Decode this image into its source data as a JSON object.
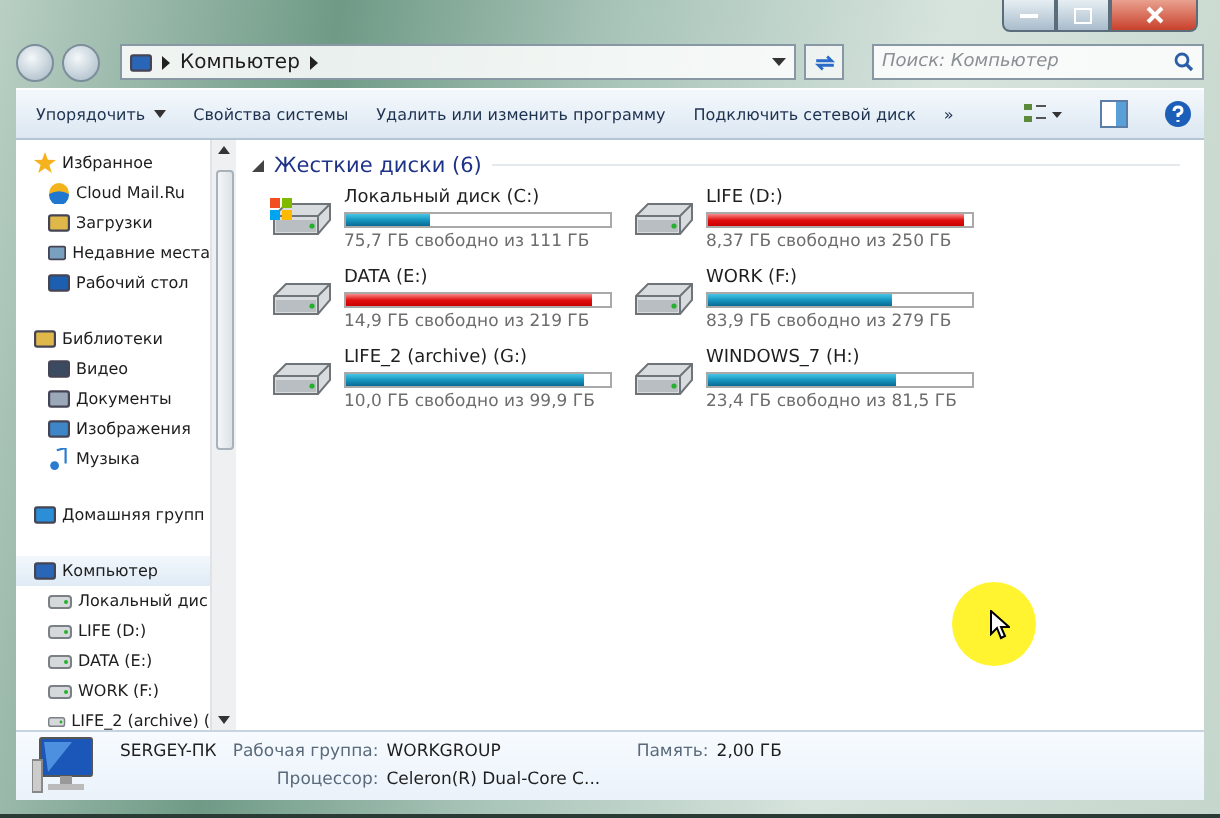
{
  "address_bar": {
    "crumbs": [
      "Компьютер"
    ]
  },
  "search": {
    "placeholder": "Поиск: Компьютер"
  },
  "toolbar": {
    "items": [
      "Упорядочить",
      "Свойства системы",
      "Удалить или изменить программу",
      "Подключить сетевой диск"
    ],
    "more": "»"
  },
  "sidebar": {
    "groups": [
      {
        "label": "Избранное",
        "selected": false,
        "children": [
          {
            "label": "Cloud Mail.Ru"
          },
          {
            "label": "Загрузки"
          },
          {
            "label": "Недавние места"
          },
          {
            "label": "Рабочий стол"
          }
        ]
      },
      {
        "label": "Библиотеки",
        "selected": false,
        "children": [
          {
            "label": "Видео"
          },
          {
            "label": "Документы"
          },
          {
            "label": "Изображения"
          },
          {
            "label": "Музыка"
          }
        ]
      },
      {
        "label": "Домашняя групп",
        "selected": false
      },
      {
        "label": "Компьютер",
        "selected": true,
        "children": [
          {
            "label": "Локальный дис"
          },
          {
            "label": "LIFE (D:)"
          },
          {
            "label": "DATA (E:)"
          },
          {
            "label": "WORK (F:)"
          },
          {
            "label": "LIFE_2 (archive) ("
          }
        ]
      }
    ]
  },
  "content": {
    "group_title": "Жесткие диски (6)",
    "drives": [
      {
        "name": "Локальный диск (C:)",
        "kind": "system",
        "level": 0.318,
        "warning": false,
        "info": "75,7 ГБ свободно из 111 ГБ"
      },
      {
        "name": "LIFE (D:)",
        "kind": "data",
        "level": 0.967,
        "warning": true,
        "info": "8,37 ГБ свободно из 250 ГБ"
      },
      {
        "name": "DATA (E:)",
        "kind": "data",
        "level": 0.932,
        "warning": true,
        "info": "14,9 ГБ свободно из 219 ГБ"
      },
      {
        "name": "WORK (F:)",
        "kind": "data",
        "level": 0.7,
        "warning": false,
        "info": "83,9 ГБ свободно из 279 ГБ"
      },
      {
        "name": "LIFE_2 (archive) (G:)",
        "kind": "data",
        "level": 0.9,
        "warning": false,
        "info": "10,0 ГБ свободно из 99,9 ГБ"
      },
      {
        "name": "WINDOWS_7 (H:)",
        "kind": "data",
        "level": 0.713,
        "warning": false,
        "info": "23,4 ГБ свободно из 81,5 ГБ"
      }
    ]
  },
  "status_bar": {
    "computer_name": "SERGEY-ПК",
    "fields": [
      {
        "label": "Рабочая группа:",
        "value": "WORKGROUP"
      },
      {
        "label": "Память:",
        "value": "2,00 ГБ"
      },
      {
        "label": "Процессор:",
        "value": "Celeron(R) Dual-Core C..."
      }
    ]
  }
}
